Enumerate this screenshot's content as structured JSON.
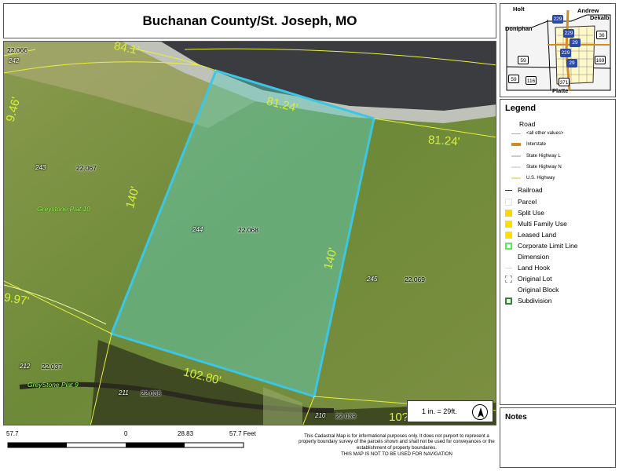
{
  "title": "Buchanan County/St. Joseph, MO",
  "map": {
    "dimensions": [
      "84.1'",
      "81.24'",
      "81.24'",
      "140'",
      "140'",
      "102.80'",
      "9.46'",
      "9.97'",
      "10?"
    ],
    "lots": [
      {
        "lot": "242",
        "id": "22.066"
      },
      {
        "lot": "243",
        "id": "22.067"
      },
      {
        "lot": "244",
        "id": "22.068"
      },
      {
        "lot": "245",
        "id": "22.069"
      },
      {
        "lot": "212",
        "id": "22.037"
      },
      {
        "lot": "211",
        "id": "22.038"
      },
      {
        "lot": "210",
        "id": "22.039"
      }
    ],
    "plats": [
      "Greystone Plat 10",
      "GreyStone Plat 9"
    ],
    "scale_ratio": "1 in. = 29ft."
  },
  "inset": {
    "labels": [
      "Holt",
      "Andrew",
      "Dekalb",
      "Doniphan",
      "Platte"
    ],
    "shields": [
      "229",
      "229",
      "36",
      "29",
      "229",
      "29",
      "59",
      "59",
      "116",
      "371",
      "169"
    ]
  },
  "legend": {
    "title": "Legend",
    "road_header": "Road",
    "road_items": [
      "<all other values>",
      "Interstate",
      "State Highway L",
      "State Highway N",
      "U.S. Highway"
    ],
    "items": [
      {
        "label": "Railroad",
        "swatch": "railroad"
      },
      {
        "label": "Parcel",
        "swatch": "#ffff00"
      },
      {
        "label": "Split Use",
        "swatch": "#ffd700"
      },
      {
        "label": "Multi Family Use",
        "swatch": "#ffdd00"
      },
      {
        "label": "Leased Land",
        "swatch": "#ffe000"
      },
      {
        "label": "Corporate Limit Line",
        "swatch": "#55ee55"
      },
      {
        "label": "Dimension",
        "swatch": "none"
      },
      {
        "label": "Land Hook",
        "swatch": "hook"
      },
      {
        "label": "Original Lot",
        "swatch": "dash"
      },
      {
        "label": "Original Block",
        "swatch": "none"
      },
      {
        "label": "Subdivision",
        "swatch": "#2a8a2a"
      }
    ]
  },
  "notes": {
    "title": "Notes"
  },
  "scalebar": {
    "labels": [
      "57.7",
      "0",
      "28.83",
      "57.7 Feet"
    ]
  },
  "disclaimer": "This Cadastral Map is for informational purposes only.  It does not purport to represent a property boundary survey of the parcels shown and shall not be used for conveyances or the establishment of property boundaries.",
  "disclaimer2": "THIS MAP IS NOT TO BE USED FOR NAVIGATION"
}
